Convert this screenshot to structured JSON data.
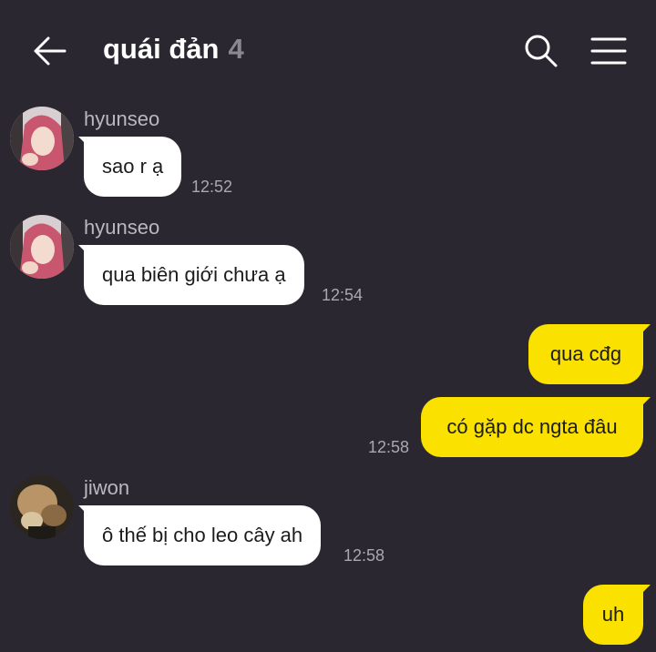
{
  "header": {
    "title": "quái đản",
    "member_count": "4"
  },
  "colors": {
    "background": "#2a2730",
    "incoming_bubble": "#ffffff",
    "outgoing_bubble": "#fae100",
    "timestamp": "#a9a8b0"
  },
  "messages": [
    {
      "sender": "hyunseo",
      "text": "sao r ạ",
      "time": "12:52",
      "direction": "incoming"
    },
    {
      "sender": "hyunseo",
      "text": "qua biên giới chưa ạ",
      "time": "12:54",
      "direction": "incoming"
    },
    {
      "text": "qua cđg",
      "direction": "outgoing"
    },
    {
      "text": "có gặp dc ngta đâu",
      "time": "12:58",
      "direction": "outgoing"
    },
    {
      "sender": "jiwon",
      "text": "ô thế bị cho leo cây ah",
      "time": "12:58",
      "direction": "incoming"
    },
    {
      "text": "uh",
      "direction": "outgoing"
    }
  ]
}
